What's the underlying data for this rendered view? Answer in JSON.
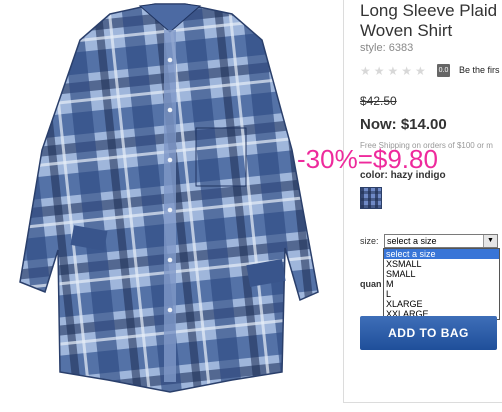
{
  "product": {
    "title_line1": "Long Sleeve Plaid Bo",
    "title_line2": "Woven Shirt",
    "style": "style: 6383",
    "image_alt": "shirt-image"
  },
  "rating": {
    "stars": "★★★★★",
    "count": "0.0",
    "review_text": "Be the firs"
  },
  "price": {
    "was": "$42.50",
    "now": "Now: $14.00"
  },
  "shipping_text": "Free Shipping on orders of $100 or m",
  "discount_overlay": "-30%=$9.80",
  "color": {
    "label": "color:",
    "value": "hazy indigo"
  },
  "size": {
    "label": "size:",
    "selected": "select a size",
    "options": [
      "select a size",
      "XSMALL",
      "SMALL",
      "M",
      "L",
      "XLARGE",
      "XXLARGE"
    ]
  },
  "quantity": {
    "label": "quan"
  },
  "add_to_bag": {
    "label": "ADD TO BAG"
  },
  "colors": {
    "discount": "#ee2a9c",
    "button": "#2a5ba8",
    "selected_option": "#3875d7"
  }
}
